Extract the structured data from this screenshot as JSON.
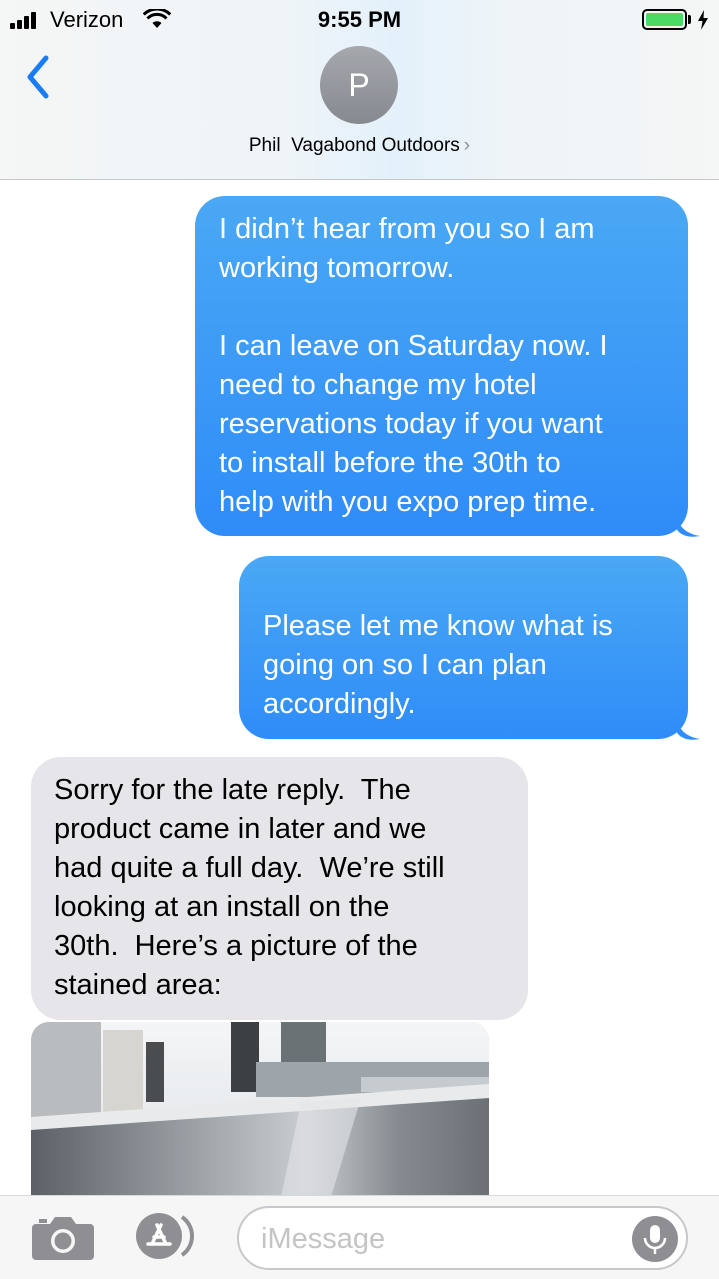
{
  "status_bar": {
    "carrier": "Verizon",
    "time": "9:55 PM",
    "battery_level": 1.0,
    "charging": true
  },
  "header": {
    "avatar_initial": "P",
    "contact_name": "Phil  Vagabond Outdoors",
    "chevron": "›"
  },
  "messages": [
    {
      "direction": "sent",
      "text": "I didn’t hear from you so I am\nworking tomorrow.\n\nI can leave on Saturday now. I\nneed to change my hotel\nreservations today if you want\nto install before the 30th to\nhelp with you expo prep time."
    },
    {
      "direction": "sent",
      "text": "Please let me know what is\ngoing on so I can plan\naccordingly."
    },
    {
      "direction": "received",
      "text": "Sorry for the late reply.  The\nproduct came in later and we\nhad quite a full day.  We’re still\nlooking at an install on the\n30th.  Here’s a picture of the\nstained area:"
    },
    {
      "direction": "received",
      "type": "photo",
      "icon": "photo-attachment"
    }
  ],
  "input_bar": {
    "placeholder": "iMessage",
    "icons": [
      "camera-icon",
      "app-store-icon",
      "microphone-icon"
    ]
  },
  "colors": {
    "sent_bubble": "#2f8cf8",
    "received_bubble": "#e5e5ea",
    "back_chevron": "#1a7cf3",
    "battery": "#4cd964"
  }
}
